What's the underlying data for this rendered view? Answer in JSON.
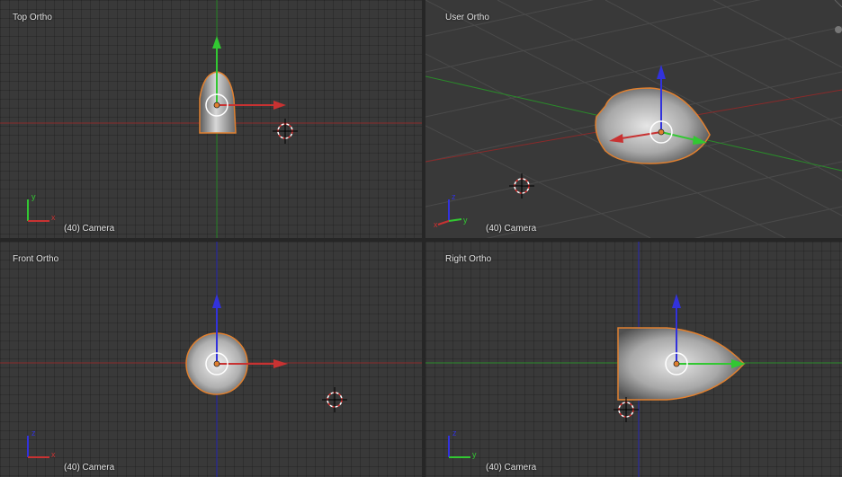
{
  "viewports": {
    "top_left": {
      "view_name": "Top Ortho",
      "object_label": "(40) Camera",
      "axis_labels": [
        "y",
        "x"
      ]
    },
    "top_right": {
      "view_name": "User Ortho",
      "object_label": "(40) Camera",
      "axis_labels": [
        "z",
        "y",
        "x"
      ]
    },
    "bottom_left": {
      "view_name": "Front Ortho",
      "object_label": "(40) Camera",
      "axis_labels": [
        "z",
        "x"
      ]
    },
    "bottom_right": {
      "view_name": "Right Ortho",
      "object_label": "(40) Camera",
      "axis_labels": [
        "z",
        "y"
      ]
    }
  },
  "colors": {
    "x_axis": "#c83232",
    "y_axis": "#32c832",
    "z_axis": "#3232dc",
    "selection_outline": "#e08030",
    "background": "#393939"
  }
}
